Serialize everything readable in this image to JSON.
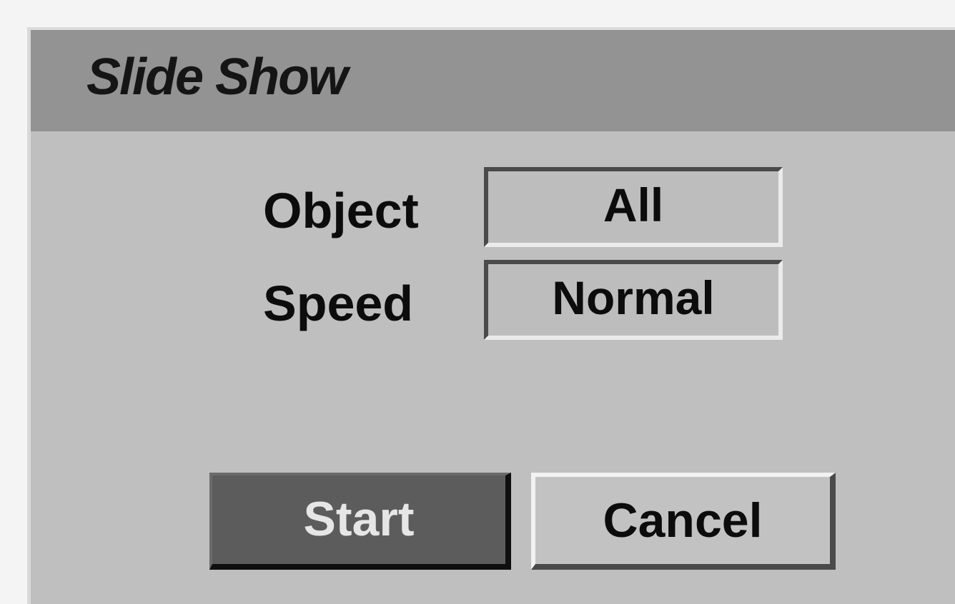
{
  "dialog": {
    "title": "Slide Show",
    "fields": {
      "object": {
        "label": "Object",
        "value": "All"
      },
      "speed": {
        "label": "Speed",
        "value": "Normal"
      }
    },
    "buttons": {
      "start": "Start",
      "cancel": "Cancel"
    },
    "focused_button": "start"
  }
}
